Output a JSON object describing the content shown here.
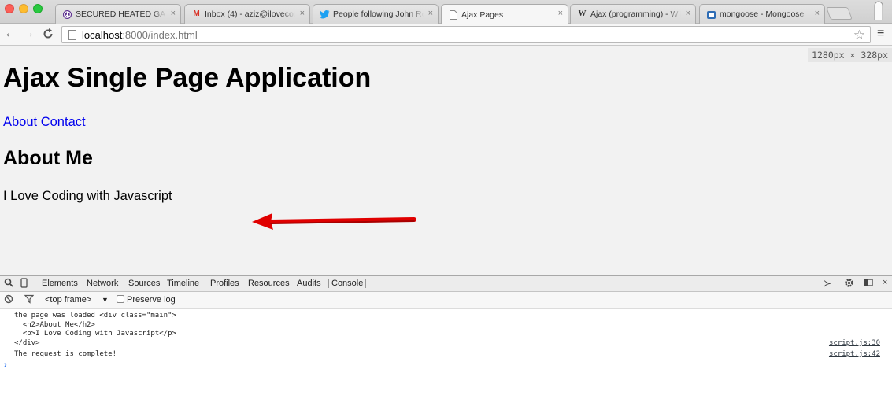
{
  "browser": {
    "tabs": [
      {
        "title": "SECURED HEATED GAR",
        "icon": "peace-icon"
      },
      {
        "title": "Inbox (4) - aziz@ilovecod",
        "icon": "gmail-icon"
      },
      {
        "title": "People following John Re",
        "icon": "twitter-icon"
      },
      {
        "title": "Ajax Pages",
        "icon": "page-icon",
        "active": true
      },
      {
        "title": "Ajax (programming) - Wik",
        "icon": "wikipedia-icon"
      },
      {
        "title": "mongoose - Mongoose",
        "icon": "mongoose-icon"
      }
    ],
    "url_host": "localhost",
    "url_rest": ":8000/index.html"
  },
  "viewport": {
    "dimensions": "1280px × 328px"
  },
  "page": {
    "title": "Ajax Single Page Application",
    "nav_links": [
      "About",
      "Contact"
    ],
    "heading": "About Me",
    "paragraph": "I Love Coding with Javascript",
    "arrow_color": "#e00000"
  },
  "devtools": {
    "tabs": [
      "Elements",
      "Network",
      "Sources",
      "Timeline",
      "Profiles",
      "Resources",
      "Audits",
      "Console"
    ],
    "active_tab": "Console",
    "frame_select": "<top frame>",
    "preserve_log_label": "Preserve log",
    "messages": [
      {
        "text": "the page was loaded <div class=\"main\">\n  <h2>About Me</h2>\n  <p>I Love Coding with Javascript</p>\n</div>",
        "source": "script.js:30"
      },
      {
        "text": "The request is complete!",
        "source": "script.js:42"
      }
    ],
    "prompt_symbol": "›"
  }
}
